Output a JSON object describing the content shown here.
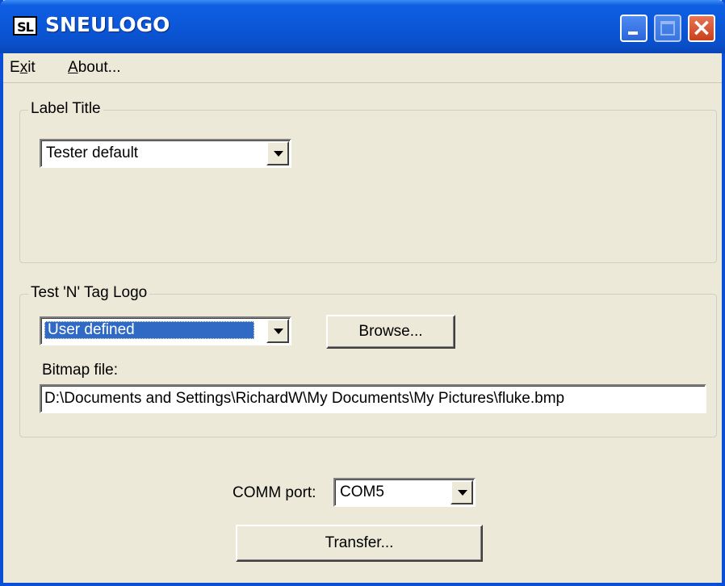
{
  "window": {
    "icon_text": "SL",
    "title": "SNEULOGO",
    "colors": {
      "titlebar": "#0b57d8",
      "face": "#ece9d8",
      "selection": "#316ac5",
      "close": "#c8401d"
    }
  },
  "menu": {
    "exit_pre": "E",
    "exit_mn": "x",
    "exit_post": "it",
    "about_mn": "A",
    "about_post": "bout..."
  },
  "label_title": {
    "group_label": "Label Title",
    "selected": "Tester default"
  },
  "logo": {
    "group_label": "Test 'N' Tag Logo",
    "selected": "User defined",
    "browse_label": "Browse...",
    "bitmap_label": "Bitmap file:",
    "bitmap_path": "D:\\Documents and Settings\\RichardW\\My Documents\\My Pictures\\fluke.bmp"
  },
  "comm": {
    "label": "COMM port:",
    "selected": "COM5"
  },
  "transfer": {
    "label": "Transfer..."
  },
  "icons": {
    "minimize": "minimize-icon",
    "maximize": "maximize-icon",
    "close": "close-icon",
    "dropdown": "chevron-down-icon"
  }
}
